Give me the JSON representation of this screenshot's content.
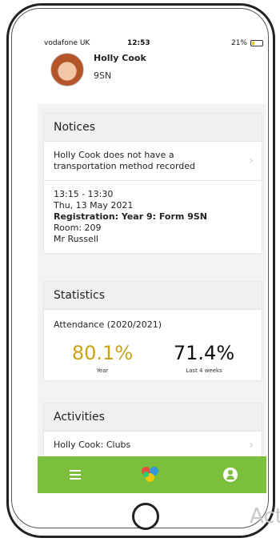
{
  "status_bar": {
    "carrier": "vodafone UK",
    "time": "12:53",
    "battery": "21%",
    "battery_level": 0.21
  },
  "profile": {
    "name": "Holly Cook",
    "form": "9SN"
  },
  "notices": {
    "header": "Notices",
    "transport_notice": [
      "Holly Cook does not have a",
      "transportation method recorded"
    ],
    "registration": {
      "time": "13:15 - 13:30",
      "date": "Thu, 13 May 2021",
      "title": "Registration: Year 9: Form 9SN",
      "room": "Room: 209",
      "teacher": "Mr Russell"
    }
  },
  "statistics": {
    "header": "Statistics",
    "attendance_label": "Attendance (2020/2021)",
    "year_value": "80.1%",
    "year_label": "Year",
    "recent_value": "71.4%",
    "recent_label": "Last 4 weeks"
  },
  "activities": {
    "header": "Activities",
    "clubs": "Holly Cook: Clubs"
  },
  "watermark": "Act",
  "colors": {
    "accent": "#7cbf3c",
    "year_value": "#c8a414",
    "header_bg": "#f0f0f0"
  },
  "icons": {
    "menu": "hamburger-icon",
    "logo": "app-logo-icon",
    "profile": "user-icon",
    "chevron": "chevron-right-icon"
  }
}
